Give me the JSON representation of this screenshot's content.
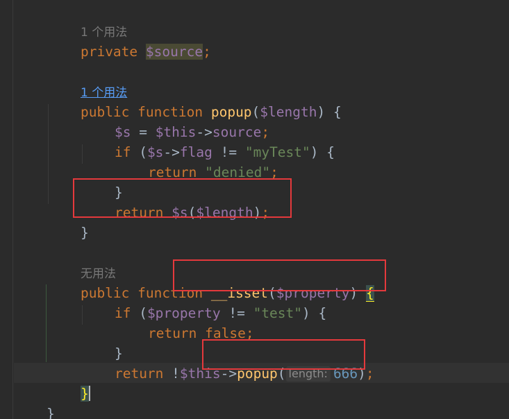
{
  "editor": {
    "language": "php",
    "theme": "darcula",
    "lines": [
      {
        "type": "hint",
        "text": "1 个用法"
      },
      {
        "kw": "private",
        "var": "$source",
        "end": ";"
      },
      {
        "type": "blank"
      },
      {
        "type": "hint-link",
        "text": "1 个用法"
      },
      {
        "kw1": "public",
        "kw2": "function",
        "fn": "popup",
        "open": "(",
        "param": "$length",
        "close": ") {"
      },
      {
        "var1": "$s",
        "op": " = ",
        "var2": "$this",
        "arrow": "->",
        "prop": "source",
        "end": ";"
      },
      {
        "kw": "if",
        "open": " (",
        "var": "$s",
        "arrow": "->",
        "prop": "flag",
        "op": " != ",
        "str": "\"myTest\"",
        "close": ") {"
      },
      {
        "kw": "return",
        "str": "\"denied\"",
        "end": ";"
      },
      {
        "text": "}"
      },
      {
        "kw": "return",
        "var1": "$s",
        "open": "(",
        "var2": "$length",
        "close": ")",
        "end": ";"
      },
      {
        "text": "}"
      },
      {
        "type": "blank"
      },
      {
        "type": "hint",
        "text": "无用法"
      },
      {
        "kw1": "public",
        "kw2": "function",
        "fn": "__isset",
        "open": "(",
        "param": "$property",
        "close": ") ",
        "brace": "{"
      },
      {
        "kw": "if",
        "open": " (",
        "var": "$property",
        "op": " != ",
        "str": "\"test\"",
        "close": ") {"
      },
      {
        "kw1": "return",
        "kw2": "false",
        "end": ";"
      },
      {
        "text": "}"
      },
      {
        "kw": "return",
        "op": " !",
        "var": "$this",
        "arrow": "->",
        "fn": "popup",
        "open": "(",
        "hint": "length:",
        "num": "666",
        "close": ")",
        "end": ";"
      },
      {
        "brace": "}"
      },
      {
        "text": "}"
      }
    ]
  },
  "colors": {
    "background": "#2b2b2b",
    "keyword": "#cc7832",
    "variable": "#9876aa",
    "function": "#ffc66d",
    "string": "#6a8759",
    "number": "#6897bb",
    "plain": "#a9b7c6",
    "annotation_box": "#e5393c"
  }
}
